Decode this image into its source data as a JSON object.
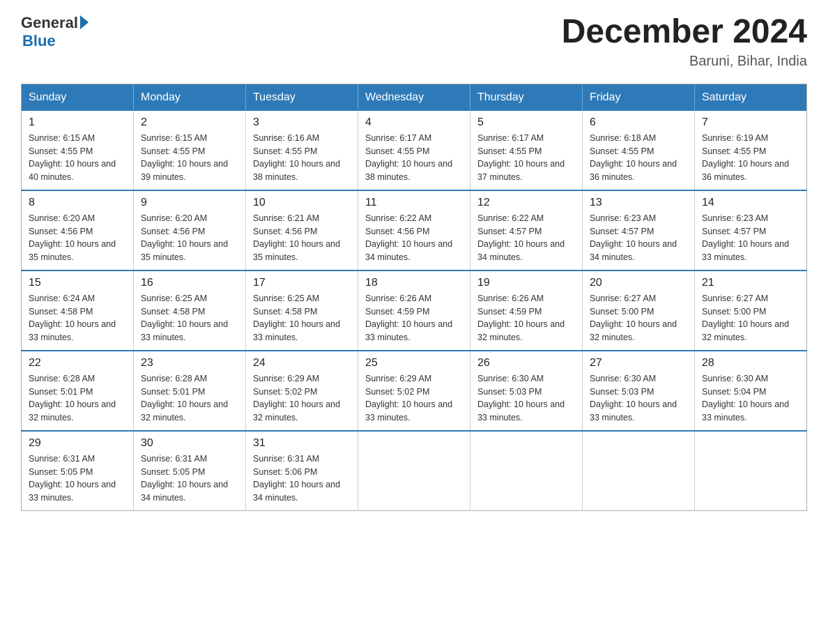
{
  "header": {
    "logo_general": "General",
    "logo_blue": "Blue",
    "month_title": "December 2024",
    "location": "Baruni, Bihar, India"
  },
  "calendar": {
    "days_of_week": [
      "Sunday",
      "Monday",
      "Tuesday",
      "Wednesday",
      "Thursday",
      "Friday",
      "Saturday"
    ],
    "weeks": [
      [
        {
          "day": "1",
          "sunrise": "Sunrise: 6:15 AM",
          "sunset": "Sunset: 4:55 PM",
          "daylight": "Daylight: 10 hours and 40 minutes."
        },
        {
          "day": "2",
          "sunrise": "Sunrise: 6:15 AM",
          "sunset": "Sunset: 4:55 PM",
          "daylight": "Daylight: 10 hours and 39 minutes."
        },
        {
          "day": "3",
          "sunrise": "Sunrise: 6:16 AM",
          "sunset": "Sunset: 4:55 PM",
          "daylight": "Daylight: 10 hours and 38 minutes."
        },
        {
          "day": "4",
          "sunrise": "Sunrise: 6:17 AM",
          "sunset": "Sunset: 4:55 PM",
          "daylight": "Daylight: 10 hours and 38 minutes."
        },
        {
          "day": "5",
          "sunrise": "Sunrise: 6:17 AM",
          "sunset": "Sunset: 4:55 PM",
          "daylight": "Daylight: 10 hours and 37 minutes."
        },
        {
          "day": "6",
          "sunrise": "Sunrise: 6:18 AM",
          "sunset": "Sunset: 4:55 PM",
          "daylight": "Daylight: 10 hours and 36 minutes."
        },
        {
          "day": "7",
          "sunrise": "Sunrise: 6:19 AM",
          "sunset": "Sunset: 4:55 PM",
          "daylight": "Daylight: 10 hours and 36 minutes."
        }
      ],
      [
        {
          "day": "8",
          "sunrise": "Sunrise: 6:20 AM",
          "sunset": "Sunset: 4:56 PM",
          "daylight": "Daylight: 10 hours and 35 minutes."
        },
        {
          "day": "9",
          "sunrise": "Sunrise: 6:20 AM",
          "sunset": "Sunset: 4:56 PM",
          "daylight": "Daylight: 10 hours and 35 minutes."
        },
        {
          "day": "10",
          "sunrise": "Sunrise: 6:21 AM",
          "sunset": "Sunset: 4:56 PM",
          "daylight": "Daylight: 10 hours and 35 minutes."
        },
        {
          "day": "11",
          "sunrise": "Sunrise: 6:22 AM",
          "sunset": "Sunset: 4:56 PM",
          "daylight": "Daylight: 10 hours and 34 minutes."
        },
        {
          "day": "12",
          "sunrise": "Sunrise: 6:22 AM",
          "sunset": "Sunset: 4:57 PM",
          "daylight": "Daylight: 10 hours and 34 minutes."
        },
        {
          "day": "13",
          "sunrise": "Sunrise: 6:23 AM",
          "sunset": "Sunset: 4:57 PM",
          "daylight": "Daylight: 10 hours and 34 minutes."
        },
        {
          "day": "14",
          "sunrise": "Sunrise: 6:23 AM",
          "sunset": "Sunset: 4:57 PM",
          "daylight": "Daylight: 10 hours and 33 minutes."
        }
      ],
      [
        {
          "day": "15",
          "sunrise": "Sunrise: 6:24 AM",
          "sunset": "Sunset: 4:58 PM",
          "daylight": "Daylight: 10 hours and 33 minutes."
        },
        {
          "day": "16",
          "sunrise": "Sunrise: 6:25 AM",
          "sunset": "Sunset: 4:58 PM",
          "daylight": "Daylight: 10 hours and 33 minutes."
        },
        {
          "day": "17",
          "sunrise": "Sunrise: 6:25 AM",
          "sunset": "Sunset: 4:58 PM",
          "daylight": "Daylight: 10 hours and 33 minutes."
        },
        {
          "day": "18",
          "sunrise": "Sunrise: 6:26 AM",
          "sunset": "Sunset: 4:59 PM",
          "daylight": "Daylight: 10 hours and 33 minutes."
        },
        {
          "day": "19",
          "sunrise": "Sunrise: 6:26 AM",
          "sunset": "Sunset: 4:59 PM",
          "daylight": "Daylight: 10 hours and 32 minutes."
        },
        {
          "day": "20",
          "sunrise": "Sunrise: 6:27 AM",
          "sunset": "Sunset: 5:00 PM",
          "daylight": "Daylight: 10 hours and 32 minutes."
        },
        {
          "day": "21",
          "sunrise": "Sunrise: 6:27 AM",
          "sunset": "Sunset: 5:00 PM",
          "daylight": "Daylight: 10 hours and 32 minutes."
        }
      ],
      [
        {
          "day": "22",
          "sunrise": "Sunrise: 6:28 AM",
          "sunset": "Sunset: 5:01 PM",
          "daylight": "Daylight: 10 hours and 32 minutes."
        },
        {
          "day": "23",
          "sunrise": "Sunrise: 6:28 AM",
          "sunset": "Sunset: 5:01 PM",
          "daylight": "Daylight: 10 hours and 32 minutes."
        },
        {
          "day": "24",
          "sunrise": "Sunrise: 6:29 AM",
          "sunset": "Sunset: 5:02 PM",
          "daylight": "Daylight: 10 hours and 32 minutes."
        },
        {
          "day": "25",
          "sunrise": "Sunrise: 6:29 AM",
          "sunset": "Sunset: 5:02 PM",
          "daylight": "Daylight: 10 hours and 33 minutes."
        },
        {
          "day": "26",
          "sunrise": "Sunrise: 6:30 AM",
          "sunset": "Sunset: 5:03 PM",
          "daylight": "Daylight: 10 hours and 33 minutes."
        },
        {
          "day": "27",
          "sunrise": "Sunrise: 6:30 AM",
          "sunset": "Sunset: 5:03 PM",
          "daylight": "Daylight: 10 hours and 33 minutes."
        },
        {
          "day": "28",
          "sunrise": "Sunrise: 6:30 AM",
          "sunset": "Sunset: 5:04 PM",
          "daylight": "Daylight: 10 hours and 33 minutes."
        }
      ],
      [
        {
          "day": "29",
          "sunrise": "Sunrise: 6:31 AM",
          "sunset": "Sunset: 5:05 PM",
          "daylight": "Daylight: 10 hours and 33 minutes."
        },
        {
          "day": "30",
          "sunrise": "Sunrise: 6:31 AM",
          "sunset": "Sunset: 5:05 PM",
          "daylight": "Daylight: 10 hours and 34 minutes."
        },
        {
          "day": "31",
          "sunrise": "Sunrise: 6:31 AM",
          "sunset": "Sunset: 5:06 PM",
          "daylight": "Daylight: 10 hours and 34 minutes."
        },
        null,
        null,
        null,
        null
      ]
    ]
  }
}
